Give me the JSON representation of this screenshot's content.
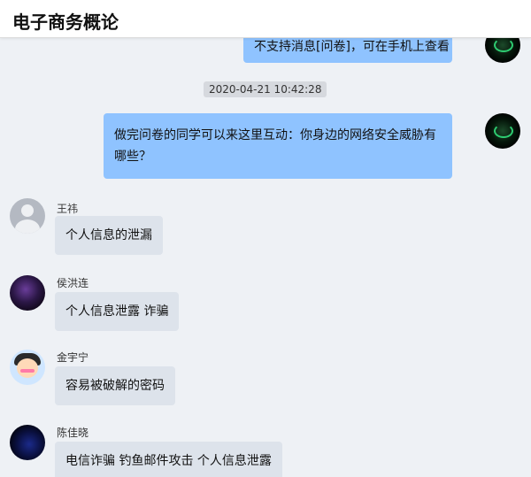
{
  "header": {
    "title": "电子商务概论"
  },
  "chat": {
    "timestamp": "2020-04-21 10:42:28",
    "messages_self": [
      {
        "text": "不支持消息[问卷]，可在手机上查看"
      },
      {
        "text": "做完问卷的同学可以来这里互动：你身边的网络安全威胁有哪些？"
      }
    ],
    "messages_others": [
      {
        "name": "王祎",
        "text": "个人信息的泄漏"
      },
      {
        "name": "侯洪连",
        "text": "个人信息泄露 诈骗"
      },
      {
        "name": "金宇宁",
        "text": "容易被破解的密码"
      },
      {
        "name": "陈佳晓",
        "text": "电信诈骗 钓鱼邮件攻击 个人信息泄露"
      }
    ]
  },
  "colors": {
    "self_bubble": "#8fc3ff",
    "other_bubble": "#dde3eb",
    "background": "#eef1f5"
  }
}
